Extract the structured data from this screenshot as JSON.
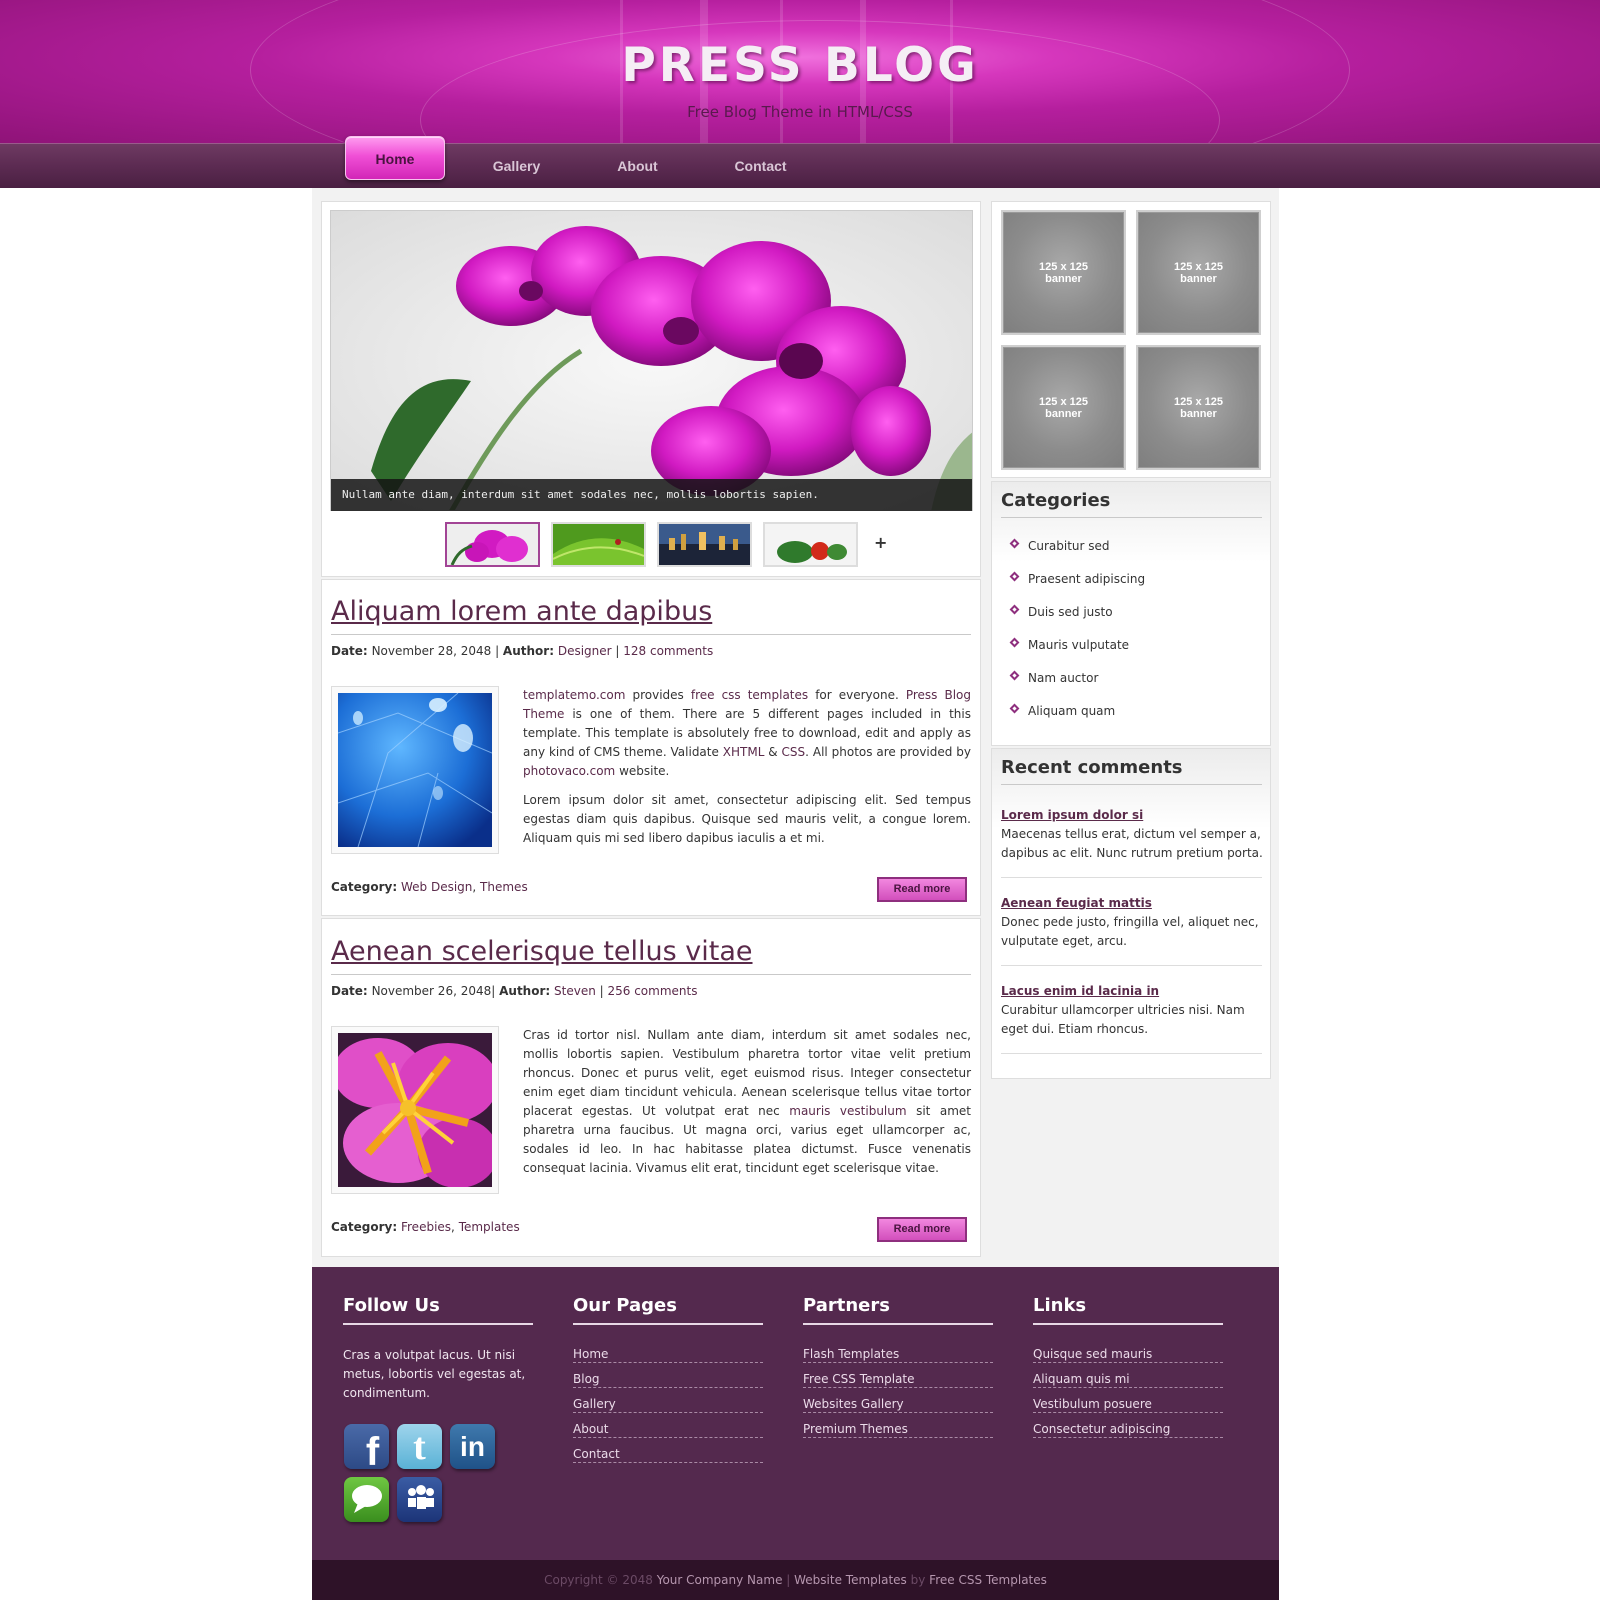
{
  "header": {
    "title": "PRESS BLOG",
    "tagline": "Free Blog Theme in HTML/CSS"
  },
  "nav": {
    "items": [
      {
        "label": "Home",
        "active": true
      },
      {
        "label": "Gallery",
        "active": false
      },
      {
        "label": "About",
        "active": false
      },
      {
        "label": "Contact",
        "active": false
      }
    ]
  },
  "slider": {
    "caption": "Nullam ante diam, interdum sit amet sodales nec, mollis lobortis sapien.",
    "thumbnails": [
      "orchid",
      "leaf-ladybug",
      "city-night",
      "vegetables"
    ],
    "active_index": 0,
    "more_label": "+"
  },
  "posts": [
    {
      "title": "Aliquam lorem ante dapibus",
      "date_label": "Date:",
      "date": "November 28, 2048",
      "author_label": "Author:",
      "author": "Designer",
      "comments": "128 comments",
      "body_p1": {
        "link1": "templatemo.com",
        "t1": " provides ",
        "link2": "free css templates",
        "t2": " for everyone. ",
        "link3": "Press Blog Theme",
        "t3": " is one of them. There are 5 different pages included in this template. This template is absolutely free to download, edit and apply as any kind of CMS theme. Validate ",
        "link4": "XHTML",
        "t4": " & ",
        "link5": "CSS",
        "t5": ". All photos are provided by ",
        "link6": "photovaco.com",
        "t6": " website."
      },
      "body_p2": "Lorem ipsum dolor sit amet, consectetur adipiscing elit. Sed tempus egestas diam quis dapibus. Quisque sed mauris velit, a congue lorem. Aliquam quis mi sed libero dapibus iaculis a et mi.",
      "category_label": "Category:",
      "categories": [
        "Web Design",
        "Themes"
      ],
      "read_more": "Read more"
    },
    {
      "title": "Aenean scelerisque tellus vitae",
      "date_label": "Date:",
      "date": "November 26, 2048",
      "author_label": "Author:",
      "author": "Steven",
      "comments": "256 comments",
      "body_t1": "Cras id tortor nisl. Nullam ante diam, interdum sit amet sodales nec, mollis lobortis sapien. Vestibulum pharetra tortor vitae velit pretium rhoncus. Donec et purus velit, eget euismod risus. Integer consectetur enim eget diam tincidunt vehicula. Aenean scelerisque tellus vitae tortor placerat egestas. Ut volutpat erat nec ",
      "body_link": "mauris vestibulum",
      "body_t2": " sit amet pharetra urna faucibus. Ut magna orci, varius eget ullamcorper ac, sodales id leo. In hac habitasse platea dictumst. Fusce venenatis consequat lacinia. Vivamus elit erat, tincidunt eget scelerisque vitae.",
      "category_label": "Category:",
      "categories": [
        "Freebies",
        "Templates"
      ],
      "read_more": "Read more"
    }
  ],
  "sidebar": {
    "banners": [
      "125 x 125\nbanner",
      "125 x 125\nbanner",
      "125 x 125\nbanner",
      "125 x 125\nbanner"
    ],
    "banner_line1": "125 x 125",
    "banner_line2": "banner",
    "categories_heading": "Categories",
    "categories": [
      "Curabitur sed",
      "Praesent adipiscing",
      "Duis sed justo",
      "Mauris vulputate",
      "Nam auctor",
      "Aliquam quam"
    ],
    "recent_heading": "Recent comments",
    "comments": [
      {
        "title": "Lorem ipsum dolor si",
        "text": "Maecenas tellus erat, dictum vel semper a, dapibus ac elit. Nunc rutrum pretium porta."
      },
      {
        "title": "Aenean feugiat mattis",
        "text": "Donec pede justo, fringilla vel, aliquet nec, vulputate eget, arcu."
      },
      {
        "title": "Lacus enim id lacinia in",
        "text": "Curabitur ullamcorper ultricies nisi. Nam eget dui. Etiam rhoncus."
      }
    ]
  },
  "footer": {
    "follow": {
      "heading": "Follow Us",
      "text": "Cras a volutpat lacus. Ut nisi metus, lobortis vel egestas at, condimentum.",
      "icons": [
        "facebook-icon",
        "twitter-icon",
        "linkedin-icon",
        "chat-icon",
        "myspace-icon"
      ]
    },
    "pages": {
      "heading": "Our Pages",
      "links": [
        "Home",
        "Blog",
        "Gallery",
        "About",
        "Contact"
      ]
    },
    "partners": {
      "heading": "Partners",
      "links": [
        "Flash Templates",
        "Free CSS Template",
        "Websites Gallery",
        "Premium Themes"
      ]
    },
    "links": {
      "heading": "Links",
      "links": [
        "Quisque sed mauris",
        "Aliquam quis mi",
        "Vestibulum posuere",
        "Consectetur adipiscing"
      ]
    },
    "copyright": {
      "prefix": "Copyright © 2048 ",
      "company": "Your Company Name",
      "sep": " | ",
      "templates": "Website Templates",
      "by": " by ",
      "free": "Free CSS Templates"
    }
  },
  "colors": {
    "brand_magenta": "#d637bd",
    "nav_purple": "#5c2b52",
    "footer_purple": "#54294e",
    "link": "#5a2a4a"
  }
}
